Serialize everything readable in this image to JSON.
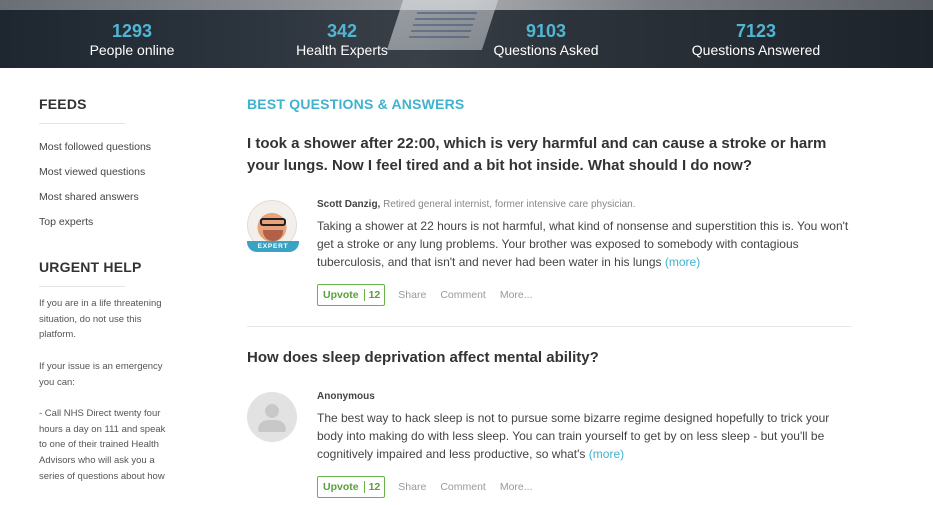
{
  "stats": [
    {
      "number": "1293",
      "label": "People online"
    },
    {
      "number": "342",
      "label": "Health Experts"
    },
    {
      "number": "9103",
      "label": "Questions Asked"
    },
    {
      "number": "7123",
      "label": "Questions Answered"
    }
  ],
  "sidebar": {
    "feeds_title": "FEEDS",
    "feeds": [
      "Most followed questions",
      "Most viewed questions",
      "Most shared answers",
      "Top experts"
    ],
    "urgent_title": "URGENT HELP",
    "urgent_paragraphs": [
      "If you are in a life threatening situation, do not use this platform.",
      "If your issue is an emergency you can:",
      "- Call NHS Direct twenty four hours a day on 111 and speak to one of their trained Health Advisors who will ask you a series of questions about how"
    ]
  },
  "main": {
    "section_title": "BEST QUESTIONS & ANSWERS",
    "items": [
      {
        "question": "I took a shower after 22:00, which is very harmful and can cause a stroke or harm your lungs. Now I feel tired and a bit hot inside. What should I do now?",
        "author_name": "Scott Danzig,",
        "author_credentials": "Retired general internist, former intensive care physician.",
        "badge": "EXPERT",
        "answer": "Taking a shower at 22 hours is not harmful, what kind of nonsense and superstition this is. You won't get a stroke or any lung problems. Your brother was exposed to somebody with contagious tuberculosis, and that isn't and never had been water in his lungs",
        "more": "(more)",
        "upvote_label": "Upvote",
        "upvote_count": "12",
        "share": "Share",
        "comment": "Comment",
        "more_actions": "More..."
      },
      {
        "question": "How does sleep deprivation affect mental ability?",
        "author_name": "Anonymous",
        "author_credentials": "",
        "answer": "The best way to hack sleep is not to pursue some bizarre regime designed hopefully to trick your body into making do with less sleep. You can train yourself to get by on less sleep - but you'll be cognitively impaired and less productive, so what's",
        "more": "(more)",
        "upvote_label": "Upvote",
        "upvote_count": "12",
        "share": "Share",
        "comment": "Comment",
        "more_actions": "More..."
      }
    ]
  },
  "colors": {
    "accent": "#3fb2cf",
    "upvote": "#5b9e3b",
    "banner": "#2b333c"
  }
}
